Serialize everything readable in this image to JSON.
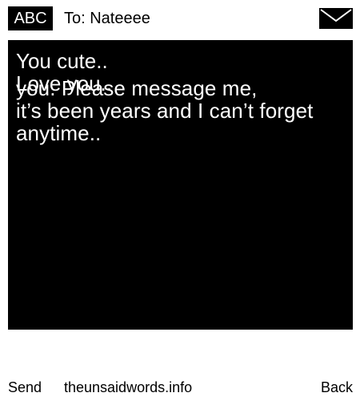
{
  "header": {
    "badge": "ABC",
    "to": "To: Nateeee",
    "icon": "envelope-icon"
  },
  "message": {
    "line1": "You cute..\nLove you..",
    "line2": "you. Please message me,\nit’s been years and I can’t forget\nanytime.."
  },
  "footer": {
    "send": "Send",
    "site": "theunsaidwords.info",
    "back": "Back"
  },
  "colors": {
    "background": "#ffffff",
    "message_bg": "#000000",
    "text_light": "#ffffff"
  }
}
